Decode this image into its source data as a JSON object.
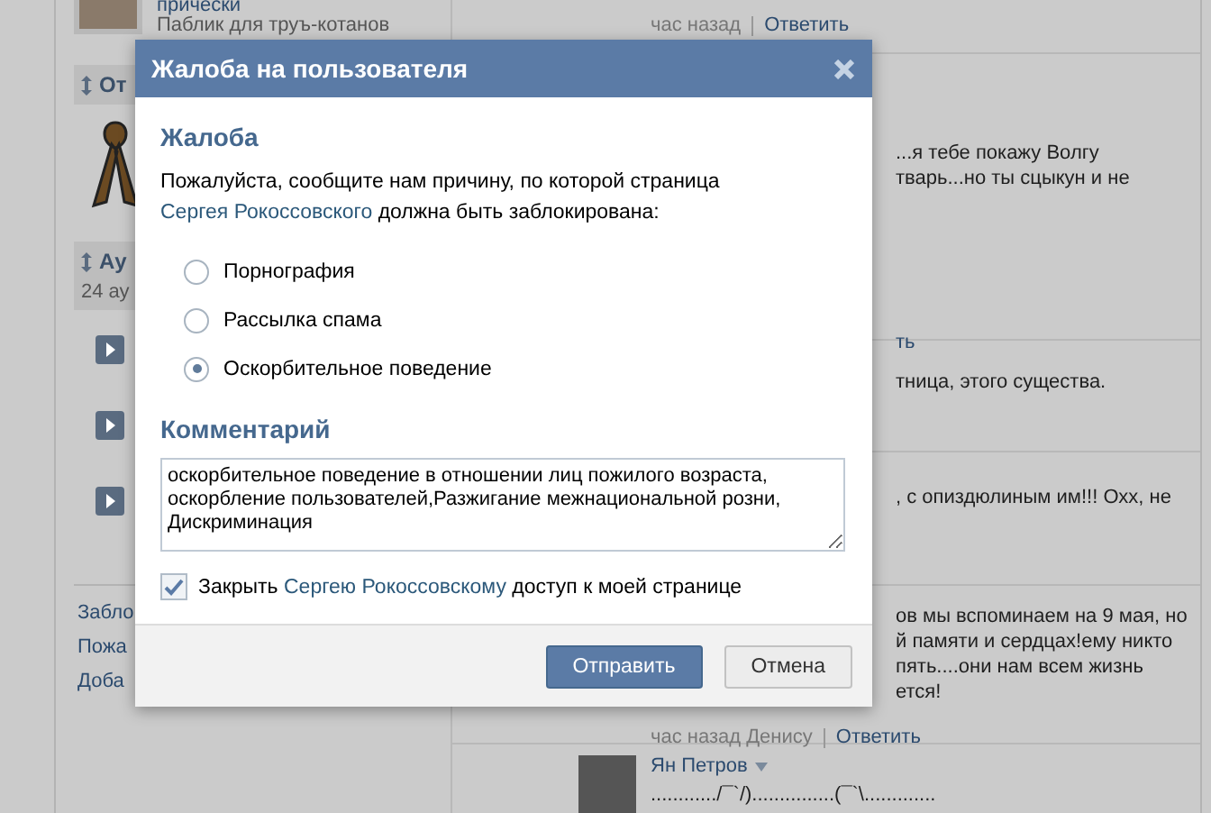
{
  "background": {
    "sidebar": {
      "group": {
        "name": "прически",
        "subtitle": "Паблик для труъ-котанов"
      },
      "sections": [
        {
          "title": "От"
        },
        {
          "title": "Ау",
          "note": "24 ау"
        }
      ],
      "links": [
        "Забло",
        "Пожа",
        "Доба"
      ]
    },
    "feed": [
      {
        "meta": "час назад",
        "reply": "Ответить"
      },
      {
        "lines": [
          "...я тебе покажу Волгу",
          "тварь...но ты сцыкун и не"
        ],
        "reply": "ть"
      },
      {
        "lines": [
          "тница, этого существа."
        ]
      },
      {
        "lines": [
          ", с опиздюлиным им!!! Охх, не"
        ]
      },
      {
        "lines": [
          "ов мы вспоминаем на 9 мая, но",
          "й памяти и сердцах!ему никто",
          "пять....они нам всем жизнь",
          "ется!"
        ],
        "meta": "час назад Денису",
        "reply": "Ответить"
      }
    ],
    "post": {
      "author": "Ян Петров",
      "text": "............/¯`/)...............(¯`\\............."
    }
  },
  "dialog": {
    "title": "Жалоба на пользователя",
    "section_title": "Жалоба",
    "prompt": {
      "before": "Пожалуйста, сообщите нам причину, по которой страница ",
      "link": "Сергея Рокоссовского",
      "after": " должна быть заблокирована:"
    },
    "options": [
      {
        "label": "Порнография",
        "selected": false
      },
      {
        "label": "Рассылка спама",
        "selected": false
      },
      {
        "label": "Оскорбительное поведение",
        "selected": true
      }
    ],
    "comment_title": "Комментарий",
    "comment": "оскорбительное поведение в отношении лиц пожилого возраста, оскорбление пользователей,Разжигание межнациональной розни, Дискриминация",
    "block": {
      "checked": true,
      "before": "Закрыть ",
      "link": "Сергею Рокоссовскому",
      "after": " доступ к моей странице"
    },
    "buttons": [
      {
        "label": "Отправить",
        "kind": "primary"
      },
      {
        "label": "Отмена",
        "kind": "secondary"
      }
    ]
  }
}
